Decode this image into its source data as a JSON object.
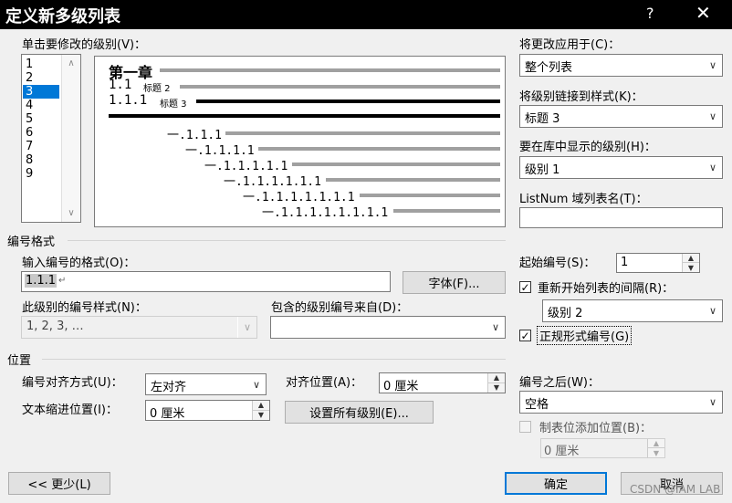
{
  "dialog": {
    "title": "定义新多级列表",
    "help_label": "?",
    "close_label": "✕"
  },
  "levels": {
    "label": "单击要修改的级别(V)：",
    "items": [
      "1",
      "2",
      "3",
      "4",
      "5",
      "6",
      "7",
      "8",
      "9"
    ],
    "selected": "3"
  },
  "preview": {
    "chapter": "第一章",
    "l2_num": "1.1",
    "l2_style": "标题 2",
    "l3_num": "1.1.1",
    "l3_style": "标题 3",
    "rows": [
      "一.1.1.1",
      "一.1.1.1.1",
      "一.1.1.1.1.1",
      "一.1.1.1.1.1.1",
      "一.1.1.1.1.1.1.1",
      "一.1.1.1.1.1.1.1.1"
    ]
  },
  "right_panel": {
    "apply_label": "将更改应用于(C)：",
    "apply_value": "整个列表",
    "link_label": "将级别链接到样式(K)：",
    "link_value": "标题 3",
    "gallery_label": "要在库中显示的级别(H)：",
    "gallery_value": "级别 1",
    "listnum_label": "ListNum 域列表名(T)：",
    "listnum_value": ""
  },
  "number_format": {
    "section_label": "编号格式",
    "format_label": "输入编号的格式(O)：",
    "format_value": "1.1.1",
    "font_button": "字体(F)...",
    "style_label": "此级别的编号样式(N)：",
    "style_value": "1, 2, 3, …",
    "include_label": "包含的级别编号来自(D)：",
    "include_value": "",
    "start_label": "起始编号(S)：",
    "start_value": "1",
    "restart_label": "重新开始列表的间隔(R)：",
    "restart_checked": true,
    "restart_value": "级别 2",
    "legal_label": "正规形式编号(G)",
    "legal_checked": true
  },
  "position": {
    "section_label": "位置",
    "align_label": "编号对齐方式(U)：",
    "align_value": "左对齐",
    "align_at_label": "对齐位置(A)：",
    "align_at_value": "0 厘米",
    "indent_label": "文本缩进位置(I)：",
    "indent_value": "0 厘米",
    "set_all_button": "设置所有级别(E)...",
    "follow_label": "编号之后(W)：",
    "follow_value": "空格",
    "tab_label": "制表位添加位置(B)：",
    "tab_checked": false,
    "tab_value": "0 厘米"
  },
  "footer": {
    "less_button": "<< 更少(L)",
    "ok_button": "确定",
    "cancel_button": "取消",
    "watermark": "CSDN @IAM LAB"
  },
  "colors": {
    "accent": "#0078d7",
    "titlebar": "#000000"
  }
}
